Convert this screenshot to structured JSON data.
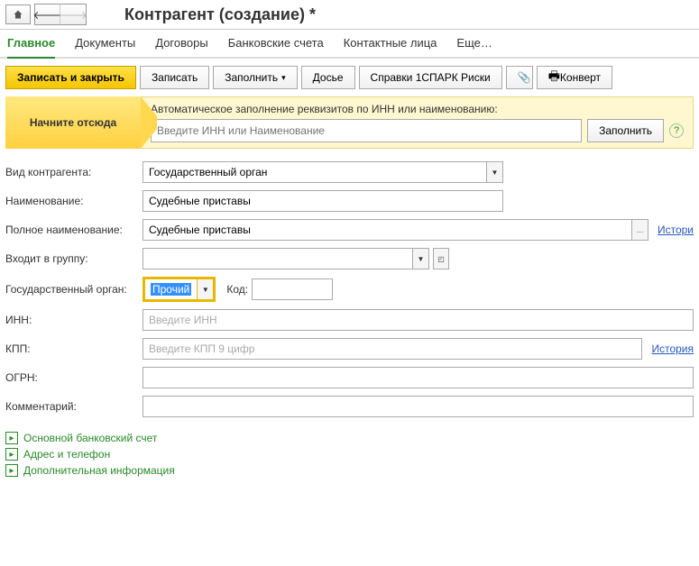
{
  "title": "Контрагент (создание) *",
  "tabs": {
    "main": "Главное",
    "docs": "Документы",
    "contracts": "Договоры",
    "banks": "Банковские счета",
    "contacts": "Контактные лица",
    "more": "Еще…"
  },
  "toolbar": {
    "save_close": "Записать и закрыть",
    "save": "Записать",
    "fill": "Заполнить",
    "dossier": "Досье",
    "spark": "Справки 1СПАРК Риски",
    "convert": "Конверт"
  },
  "autofill": {
    "start_here": "Начните отсюда",
    "label": "Автоматическое заполнение реквизитов по ИНН или наименованию:",
    "placeholder": "Введите ИНН или Наименование",
    "btn": "Заполнить"
  },
  "labels": {
    "type": "Вид контрагента:",
    "name": "Наименование:",
    "fullname": "Полное наименование:",
    "group": "Входит в группу:",
    "gov": "Государственный орган:",
    "code": "Код:",
    "inn": "ИНН:",
    "kpp": "КПП:",
    "ogrn": "ОГРН:",
    "comment": "Комментарий:"
  },
  "values": {
    "type": "Государственный орган",
    "name": "Судебные приставы",
    "fullname": "Судебные приставы",
    "group": "",
    "gov": "Прочий",
    "code": "",
    "inn": "",
    "kpp": "",
    "ogrn": "",
    "comment": ""
  },
  "placeholders": {
    "inn": "Введите ИНН",
    "kpp": "Введите КПП 9 цифр"
  },
  "links": {
    "history": "История",
    "history_full": "Истори"
  },
  "sections": {
    "bank": "Основной банковский счет",
    "address": "Адрес и телефон",
    "extra": "Дополнительная информация"
  }
}
